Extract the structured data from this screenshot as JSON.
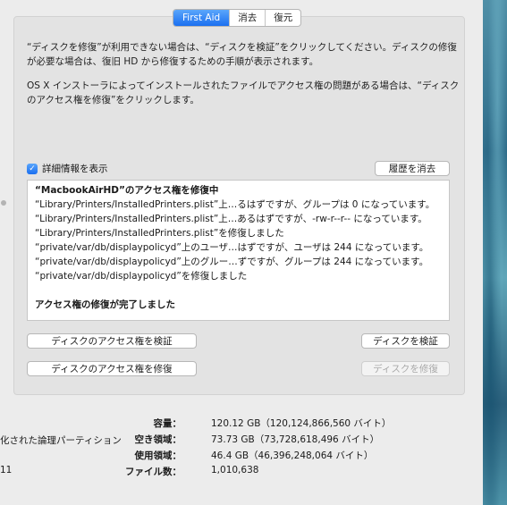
{
  "tabs": [
    {
      "label": "First Aid",
      "active": true
    },
    {
      "label": "消去",
      "active": false
    },
    {
      "label": "復元",
      "active": false
    }
  ],
  "info": {
    "paragraph1": "“ディスクを修復”が利用できない場合は、“ディスクを検証”をクリックしてください。ディスクの修復が必要な場合は、復旧 HD から修復するための手順が表示されます。",
    "paragraph2": "OS X インストーラによってインストールされたファイルでアクセス権の問題がある場合は、“ディスクのアクセス権を修復”をクリックします。"
  },
  "details": {
    "checkbox_label": "詳細情報を表示",
    "checked": true,
    "clear_history_label": "履歴を消去"
  },
  "log": {
    "header": "“MacbookAirHD”のアクセス権を修復中",
    "lines": [
      "“Library/Printers/InstalledPrinters.plist”上…るはずですが、グループは 0 になっています。",
      "“Library/Printers/InstalledPrinters.plist”上…あるはずですが、-rw-r--r-- になっています。",
      "“Library/Printers/InstalledPrinters.plist”を修復しました",
      "“private/var/db/displaypolicyd”上のユーザ…はずですが、ユーザは 244 になっています。",
      "“private/var/db/displaypolicyd”上のグルー…ずですが、グループは 244 になっています。",
      "“private/var/db/displaypolicyd”を修復しました"
    ],
    "footer": "アクセス権の修復が完了しました"
  },
  "buttons": {
    "verify_permissions": "ディスクのアクセス権を検証",
    "repair_permissions": "ディスクのアクセス権を修復",
    "verify_disk": "ディスクを検証",
    "repair_disk": "ディスクを修復",
    "repair_disk_enabled": false
  },
  "left_fragments": {
    "partition_text": "化された論理パーティション",
    "number_text": "11"
  },
  "stats": [
    {
      "label": "容量：",
      "value": "120.12 GB（120,124,866,560 バイト）"
    },
    {
      "label": "空き領域：",
      "value": "73.73 GB（73,728,618,496 バイト）"
    },
    {
      "label": "使用領域：",
      "value": "46.4 GB（46,396,248,064 バイト）"
    },
    {
      "label": "ファイル数：",
      "value": "1,010,638"
    }
  ],
  "colors": {
    "accent": "#1b6ff0",
    "window_bg": "#ececec",
    "panel_bg": "#e3e3e3"
  }
}
